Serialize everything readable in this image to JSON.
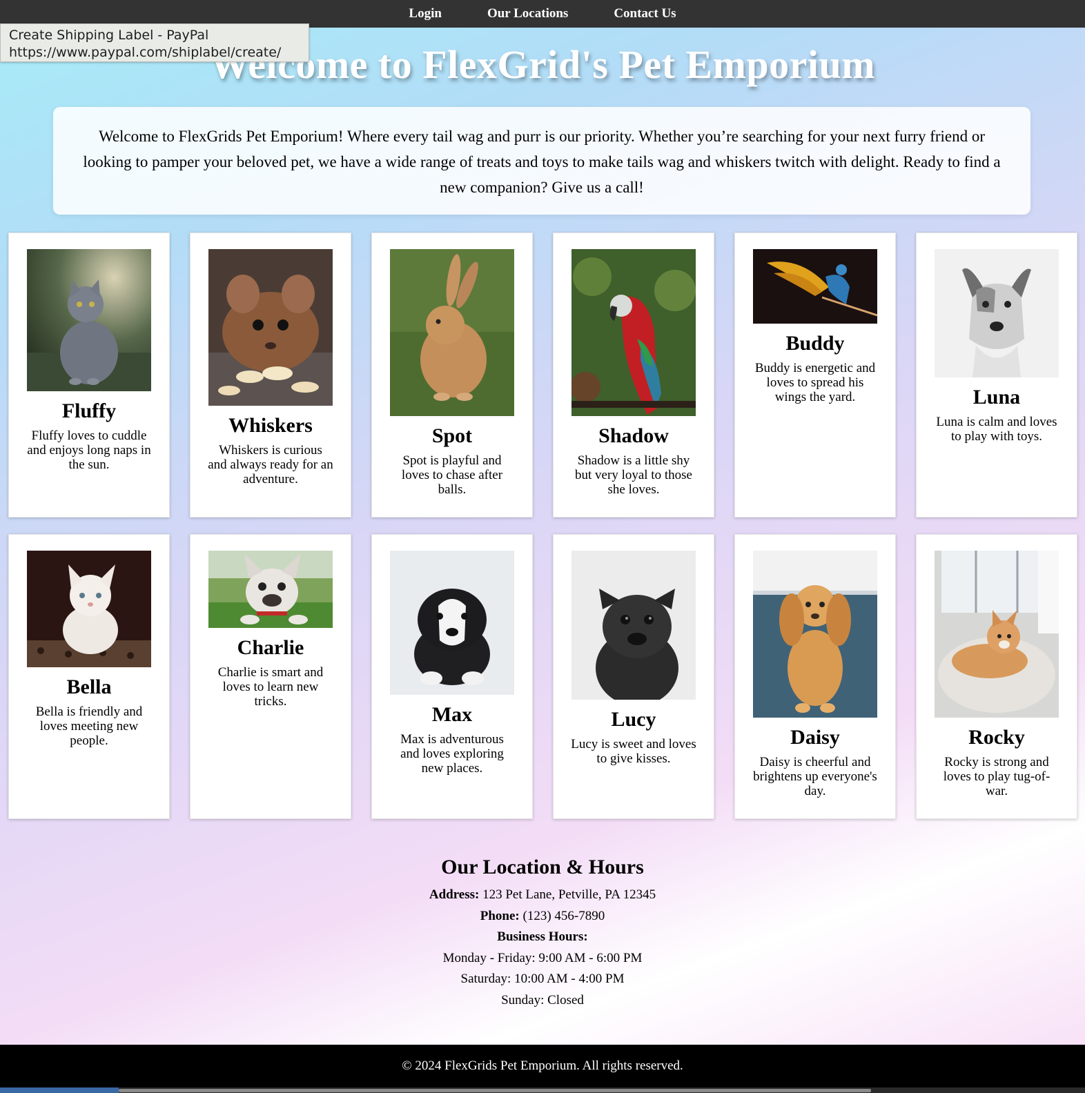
{
  "nav": {
    "login": "Login",
    "locations": "Our Locations",
    "contact": "Contact Us"
  },
  "tooltip": {
    "title": "Create Shipping Label - PayPal",
    "url": "https://www.paypal.com/shiplabel/create/"
  },
  "hero": {
    "title": "Welcome to FlexGrid's Pet Emporium",
    "intro": "Welcome to FlexGrids Pet Emporium! Where every tail wag and purr is our priority. Whether you’re searching for your next furry friend or looking to pamper your beloved pet, we have a wide range of treats and toys to make tails wag and whiskers twitch with delight. Ready to find a new companion? Give us a call!"
  },
  "pets": [
    {
      "name": "Fluffy",
      "desc": "Fluffy loves to cuddle and enjoys long naps in the sun.",
      "image": "gray-cat-photo"
    },
    {
      "name": "Whiskers",
      "desc": "Whiskers is curious and always ready for an adventure.",
      "image": "mouse-photo"
    },
    {
      "name": "Spot",
      "desc": "Spot is playful and loves to chase after balls.",
      "image": "rabbit-photo"
    },
    {
      "name": "Shadow",
      "desc": "Shadow is a little shy but very loyal to those she loves.",
      "image": "red-macaw-photo"
    },
    {
      "name": "Buddy",
      "desc": "Buddy is energetic and loves to spread his wings the yard.",
      "image": "blue-gold-macaw-photo"
    },
    {
      "name": "Luna",
      "desc": "Luna is calm and loves to play with toys.",
      "image": "bw-dog-photo"
    },
    {
      "name": "Bella",
      "desc": "Bella is friendly and loves meeting new people.",
      "image": "white-kitten-photo"
    },
    {
      "name": "Charlie",
      "desc": "Charlie is smart and loves to learn new tricks.",
      "image": "french-bulldog-photo"
    },
    {
      "name": "Max",
      "desc": "Max is adventurous and loves exploring new places.",
      "image": "puppy-photo"
    },
    {
      "name": "Lucy",
      "desc": "Lucy is sweet and loves to give kisses.",
      "image": "pug-photo"
    },
    {
      "name": "Daisy",
      "desc": "Daisy is cheerful and brightens up everyone's day.",
      "image": "cocker-spaniel-photo"
    },
    {
      "name": "Rocky",
      "desc": "Rocky is strong and loves to play tug-of-war.",
      "image": "shiba-inu-photo"
    }
  ],
  "info": {
    "heading": "Our Location & Hours",
    "address_label": "Address:",
    "address": "123 Pet Lane, Petville, PA 12345",
    "phone_label": "Phone:",
    "phone": "(123) 456-7890",
    "hours_label": "Business Hours:",
    "weekday": "Monday - Friday: 9:00 AM - 6:00 PM",
    "saturday": "Saturday: 10:00 AM - 4:00 PM",
    "sunday": "Sunday: Closed"
  },
  "footer": {
    "text": "© 2024 FlexGrids Pet Emporium. All rights reserved."
  },
  "colors": {
    "nav_bg": "#333333",
    "footer_bg": "#000000",
    "card_bg": "#ffffff"
  }
}
